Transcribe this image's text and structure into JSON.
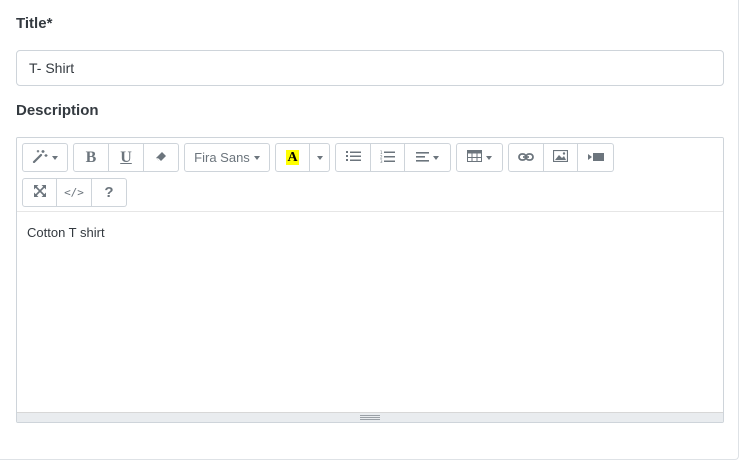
{
  "title_field": {
    "label": "Title*",
    "value": "T- Shirt"
  },
  "description_field": {
    "label": "Description",
    "content": "Cotton T shirt"
  },
  "toolbar": {
    "style_icon": "magic-wand-icon",
    "bold_label": "B",
    "underline_label": "U",
    "clear_format_icon": "eraser-icon",
    "font_name": "Fira Sans",
    "color_label": "A",
    "highlight_color": "#ffff00",
    "unordered_list_icon": "unordered-list-icon",
    "ordered_list_icon": "ordered-list-icon",
    "align_icon": "align-left-icon",
    "table_icon": "table-icon",
    "link_icon": "link-icon",
    "image_icon": "image-icon",
    "video_icon": "video-icon",
    "fullscreen_icon": "expand-icon",
    "code_view_label": "</>",
    "help_label": "?"
  }
}
